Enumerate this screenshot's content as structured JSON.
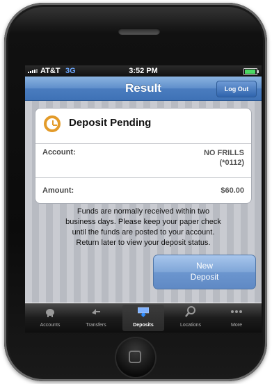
{
  "status_bar": {
    "carrier": "AT&T",
    "network": "3G",
    "time": "3:52 PM"
  },
  "nav": {
    "title": "Result",
    "logout_label": "Log Out"
  },
  "card": {
    "title": "Deposit Pending",
    "account_label": "Account:",
    "account_value_line1": "NO FRILLS",
    "account_value_line2": "(*0112)",
    "amount_label": "Amount:",
    "amount_value": "$60.00"
  },
  "info_text": {
    "line1": "Funds are normally received within two",
    "line2": "business days. Please keep your paper check",
    "line3": "until the funds are posted to your account.",
    "line4": "Return later to view your deposit status."
  },
  "new_deposit_button": {
    "line1": "New",
    "line2": "Deposit"
  },
  "tabs": [
    {
      "label": "Accounts",
      "icon": "piggy-bank-icon",
      "active": false
    },
    {
      "label": "Transfers",
      "icon": "transfer-arrows-icon",
      "active": false
    },
    {
      "label": "Deposits",
      "icon": "deposit-check-icon",
      "active": true
    },
    {
      "label": "Locations",
      "icon": "magnifier-icon",
      "active": false
    },
    {
      "label": "More",
      "icon": "more-dots-icon",
      "active": false
    }
  ],
  "colors": {
    "nav_blue": "#4a7cbf",
    "clock_orange": "#e39b2a",
    "button_blue": "#7fa6d8"
  }
}
